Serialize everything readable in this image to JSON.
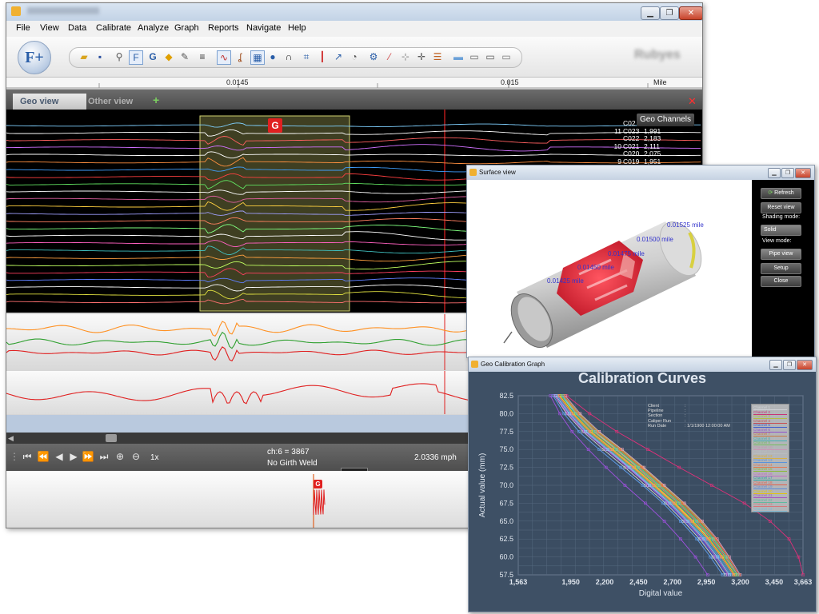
{
  "main": {
    "menu": [
      "File",
      "View",
      "Data",
      "Calibrate",
      "Analyze",
      "Graph",
      "Reports",
      "Navigate",
      "Help"
    ],
    "logo": "F+",
    "blurred_text": "Rubyes",
    "ruler": {
      "left_value": "0.0145",
      "right_value": "0.015",
      "unit": "Mile"
    },
    "tabs": {
      "active": "Geo view",
      "inactive": "Other view",
      "add": "+",
      "close": "✕"
    },
    "geo_panel": {
      "header": "Geo Channels",
      "girth_marker": "G",
      "channels": [
        {
          "idx": "",
          "code": "C02",
          "value": ""
        },
        {
          "idx": "11",
          "code": "C023",
          "value": "1,991"
        },
        {
          "idx": "",
          "code": "C022",
          "value": "2,183"
        },
        {
          "idx": "10",
          "code": "C021",
          "value": "2,111"
        },
        {
          "idx": "",
          "code": "C020",
          "value": "2,075"
        },
        {
          "idx": "9",
          "code": "C019",
          "value": "1,951"
        }
      ]
    },
    "player": {
      "speed": "1x",
      "channel_reading": "ch:6 = 3867",
      "weld_status": "No Girth Weld",
      "velocity": "2.0336 mph"
    },
    "overview": {
      "marker": "G"
    }
  },
  "surface_view": {
    "title": "Surface view",
    "refresh": "Refresh",
    "reset": "Reset view",
    "shading_label": "Shading mode:",
    "shading_value": "Solid",
    "view_label": "View mode:",
    "view_value": "Pipe view",
    "setup": "Setup",
    "close": "Close",
    "miles": [
      "0.01525 mile",
      "0.01500 mile",
      "0.01475 mile",
      "0.01450 mile",
      "0.01425 mile"
    ]
  },
  "calibration": {
    "window_title": "Geo Calibration Graph",
    "info": [
      {
        "k": "Client",
        "v": ":"
      },
      {
        "k": "Pipeline",
        "v": ":"
      },
      {
        "k": "Section",
        "v": ":"
      },
      {
        "k": "Caliper Run",
        "v": ":"
      },
      {
        "k": "Run Date",
        "v": ": 1/1/1900 12:00:00 AM"
      }
    ],
    "colors": {
      "background": "#3e5065",
      "plot_bg": "#3b4d62",
      "grid": "#56697f"
    }
  },
  "chart_data": {
    "type": "line",
    "title": "Calibration Curves",
    "xlabel": "Digital value",
    "ylabel": "Actual value (mm)",
    "xlim": [
      1563,
      3663
    ],
    "ylim": [
      57.5,
      82.5
    ],
    "xticks": [
      "1,563",
      "1,950",
      "2,200",
      "2,450",
      "2,700",
      "2,950",
      "3,200",
      "3,450",
      "3,663"
    ],
    "yticks": [
      "82.5",
      "80.0",
      "77.5",
      "75.0",
      "72.5",
      "70.0",
      "67.5",
      "65.0",
      "62.5",
      "60.0",
      "57.5"
    ],
    "y": [
      82.5,
      80.0,
      77.5,
      75.0,
      72.5,
      70.0,
      67.5,
      65.0,
      62.5,
      60.0,
      57.5
    ],
    "series": [
      {
        "name": "Channel 1",
        "color": "#e8e8e8",
        "values": [
          1880,
          1990,
          2120,
          2290,
          2440,
          2580,
          2720,
          2850,
          2980,
          3080,
          3170
        ]
      },
      {
        "name": "Channel 2",
        "color": "#e0307a",
        "values": [
          1920,
          2090,
          2290,
          2520,
          2750,
          2990,
          3230,
          3420,
          3560,
          3630,
          3663
        ]
      },
      {
        "name": "Channel 3",
        "color": "#c8d040",
        "values": [
          1900,
          2010,
          2150,
          2320,
          2480,
          2630,
          2780,
          2910,
          3020,
          3110,
          3190
        ]
      },
      {
        "name": "Channel 4",
        "color": "#e05050",
        "values": [
          1860,
          1960,
          2090,
          2250,
          2410,
          2560,
          2700,
          2840,
          2960,
          3060,
          3150
        ]
      },
      {
        "name": "Channel 5",
        "color": "#4060e0",
        "values": [
          1840,
          1930,
          2050,
          2210,
          2370,
          2520,
          2660,
          2790,
          2910,
          3010,
          3100
        ]
      },
      {
        "name": "Channel 6",
        "color": "#a050e0",
        "values": [
          1800,
          1870,
          1960,
          2080,
          2210,
          2350,
          2500,
          2640,
          2760,
          2870,
          2960
        ]
      },
      {
        "name": "Channel 7",
        "color": "#e08040",
        "values": [
          1870,
          1980,
          2110,
          2270,
          2430,
          2580,
          2720,
          2860,
          2990,
          3090,
          3180
        ]
      },
      {
        "name": "Channel 8",
        "color": "#40c0c0",
        "values": [
          1850,
          1950,
          2070,
          2230,
          2390,
          2540,
          2690,
          2820,
          2950,
          3050,
          3140
        ]
      },
      {
        "name": "Channel 9",
        "color": "#80d060",
        "values": [
          1890,
          2000,
          2130,
          2300,
          2460,
          2610,
          2760,
          2890,
          3010,
          3100,
          3180
        ]
      },
      {
        "name": "Channel 10",
        "color": "#e0a0c0",
        "values": [
          1910,
          2020,
          2160,
          2330,
          2490,
          2640,
          2790,
          2920,
          3030,
          3120,
          3200
        ]
      },
      {
        "name": "Channel 11",
        "color": "#d0d0d0",
        "values": [
          1830,
          1920,
          2040,
          2190,
          2350,
          2500,
          2650,
          2780,
          2900,
          3000,
          3090
        ]
      },
      {
        "name": "Channel 12",
        "color": "#f0c040",
        "values": [
          1870,
          1970,
          2100,
          2260,
          2420,
          2570,
          2710,
          2850,
          2970,
          3070,
          3160
        ]
      },
      {
        "name": "Channel 13",
        "color": "#60a0f0",
        "values": [
          1820,
          1900,
          2010,
          2160,
          2320,
          2480,
          2630,
          2760,
          2880,
          2980,
          3070
        ]
      },
      {
        "name": "Channel 14",
        "color": "#ff7f50",
        "values": [
          1890,
          1990,
          2120,
          2280,
          2440,
          2590,
          2740,
          2870,
          2990,
          3090,
          3170
        ]
      },
      {
        "name": "Channel 15",
        "color": "#9acd32",
        "values": [
          1860,
          1960,
          2080,
          2240,
          2400,
          2550,
          2700,
          2830,
          2960,
          3060,
          3150
        ]
      },
      {
        "name": "Channel 16",
        "color": "#da70d6",
        "values": [
          1840,
          1940,
          2060,
          2220,
          2380,
          2530,
          2680,
          2810,
          2930,
          3030,
          3120
        ]
      },
      {
        "name": "Channel 17",
        "color": "#20b2aa",
        "values": [
          1880,
          1980,
          2110,
          2270,
          2430,
          2580,
          2730,
          2860,
          2980,
          3080,
          3170
        ]
      },
      {
        "name": "Channel 18",
        "color": "#ff6347",
        "values": [
          1900,
          2000,
          2140,
          2310,
          2470,
          2620,
          2770,
          2900,
          3020,
          3110,
          3190
        ]
      },
      {
        "name": "Channel 19",
        "color": "#6495ed",
        "values": [
          1850,
          1950,
          2070,
          2230,
          2390,
          2540,
          2690,
          2820,
          2940,
          3040,
          3130
        ]
      },
      {
        "name": "Channel 20",
        "color": "#ffd700",
        "values": [
          1870,
          1970,
          2100,
          2260,
          2420,
          2570,
          2720,
          2850,
          2970,
          3070,
          3160
        ]
      },
      {
        "name": "Channel 21",
        "color": "#ba55d3",
        "values": [
          1830,
          1930,
          2050,
          2210,
          2370,
          2520,
          2670,
          2800,
          2920,
          3020,
          3110
        ]
      },
      {
        "name": "Channel 22",
        "color": "#66cdaa",
        "values": [
          1890,
          1990,
          2130,
          2290,
          2450,
          2600,
          2750,
          2880,
          3000,
          3100,
          3180
        ]
      },
      {
        "name": "Channel 23",
        "color": "#f08080",
        "values": [
          1860,
          1960,
          2090,
          2250,
          2410,
          2560,
          2710,
          2840,
          2960,
          3060,
          3150
        ]
      },
      {
        "name": "Channel 24",
        "color": "#87ceeb",
        "values": [
          1840,
          1940,
          2060,
          2220,
          2380,
          2530,
          2680,
          2810,
          2930,
          3030,
          3120
        ]
      }
    ]
  }
}
